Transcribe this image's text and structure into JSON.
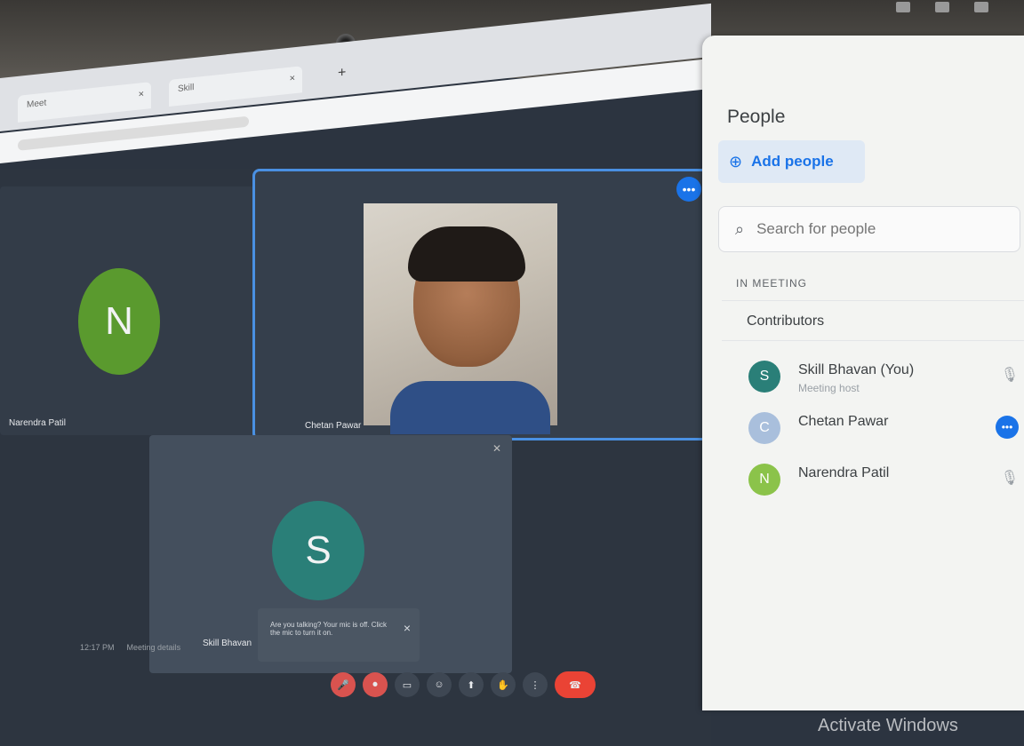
{
  "browser": {
    "tabs": [
      {
        "label": "Meet",
        "close": "×"
      },
      {
        "label": "Skill",
        "close": "×"
      }
    ],
    "new_tab": "+"
  },
  "meeting": {
    "tiles": [
      {
        "name": "Narendra Patil",
        "avatar": "N",
        "avatar_color": "#5a9a2e"
      },
      {
        "name": "Chetan Pawar"
      },
      {
        "name": "Skill Bhavan",
        "avatar": "S",
        "avatar_color": "#2a7f78"
      }
    ],
    "more_label": "•••",
    "toast": {
      "text": "Are you talking? Your mic is off. Click the mic to turn it on.",
      "close": "×"
    },
    "bottom_meta": [
      "12:17 PM",
      "Meeting details"
    ]
  },
  "controls": {
    "items": [
      {
        "name": "mic",
        "glyph": "🎤"
      },
      {
        "name": "camera",
        "glyph": "⏺"
      },
      {
        "name": "captions",
        "glyph": "▭"
      },
      {
        "name": "emoji",
        "glyph": "☺"
      },
      {
        "name": "present",
        "glyph": "⬆"
      },
      {
        "name": "hand",
        "glyph": "✋"
      },
      {
        "name": "more",
        "glyph": "⋮"
      },
      {
        "name": "end",
        "glyph": "☎"
      }
    ]
  },
  "people_panel": {
    "title": "People",
    "add_people": "Add people",
    "search_placeholder": "Search for people",
    "section": "IN MEETING",
    "group": "Contributors",
    "people": [
      {
        "initial": "S",
        "name": "Skill Bhavan (You)",
        "subtitle": "Meeting host",
        "color": "#2a7f78",
        "right": "🎙"
      },
      {
        "initial": "C",
        "name": "Chetan Pawar",
        "subtitle": "",
        "color": "#a9bfdc",
        "right": "•••"
      },
      {
        "initial": "N",
        "name": "Narendra Patil",
        "subtitle": "",
        "color": "#8bc34a",
        "right": "🎙"
      }
    ]
  },
  "watermark": "Activate Windows"
}
